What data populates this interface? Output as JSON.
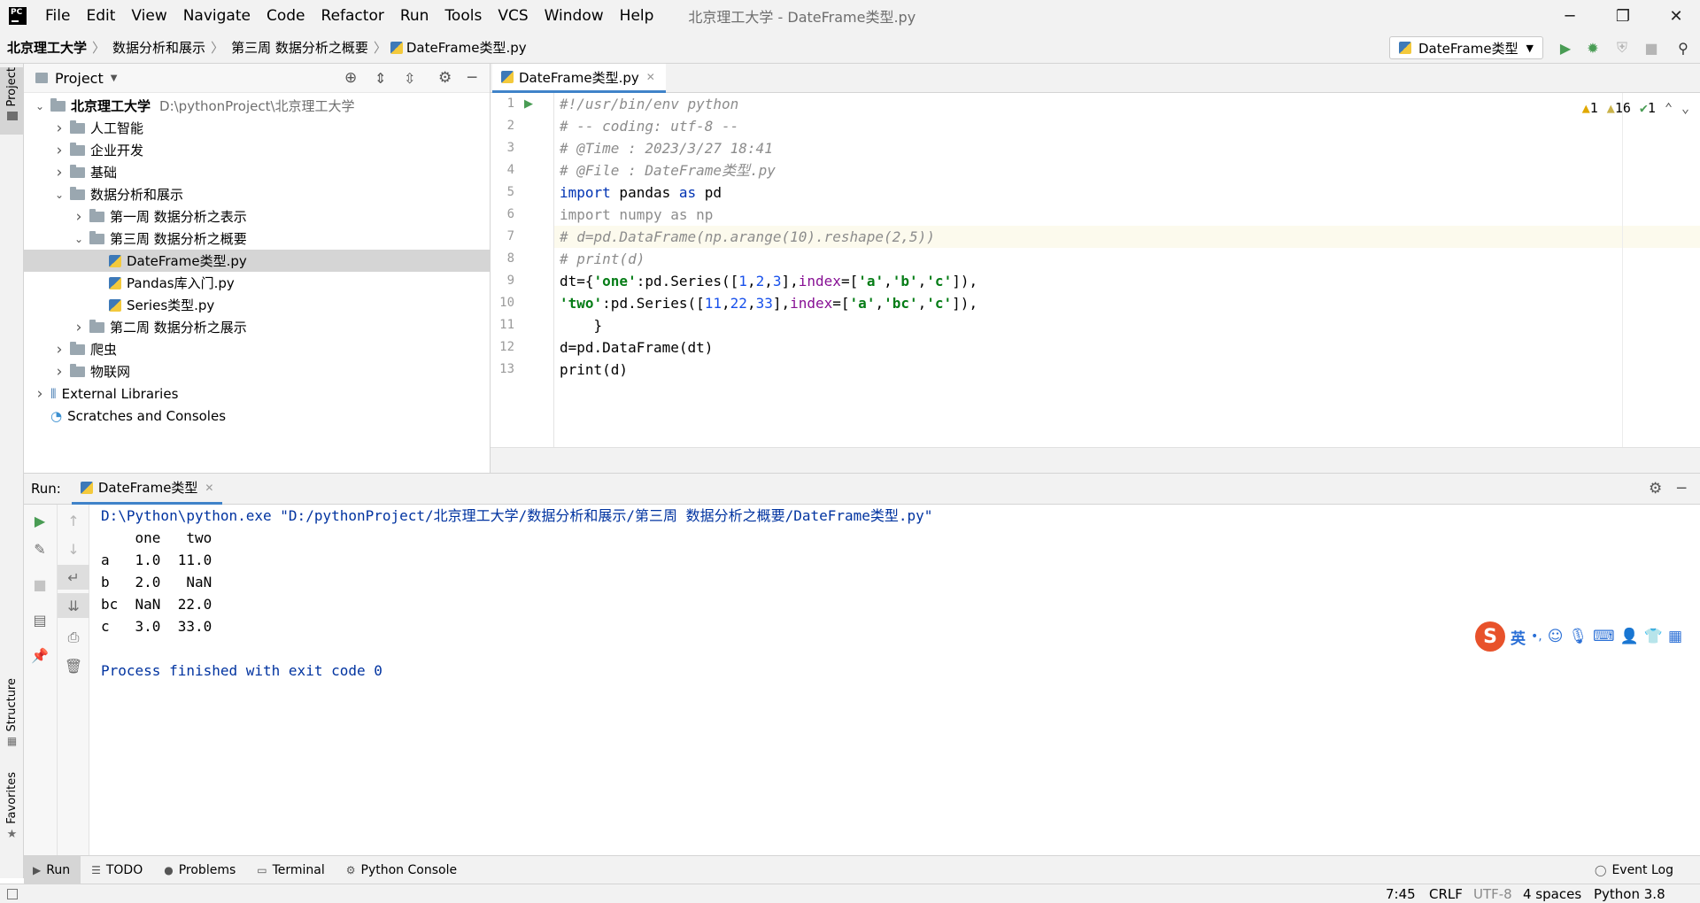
{
  "titlebar": {
    "menu": [
      "File",
      "Edit",
      "View",
      "Navigate",
      "Code",
      "Refactor",
      "Run",
      "Tools",
      "VCS",
      "Window",
      "Help"
    ],
    "window_title": "北京理工大学 - DateFrame类型.py",
    "minimize": "─",
    "restore": "❐",
    "close": "✕"
  },
  "navbar": {
    "crumbs": [
      "北京理工大学",
      "数据分析和展示",
      "第三周 数据分析之概要",
      "DateFrame类型.py"
    ],
    "run_config": "DateFrame类型"
  },
  "left_strip": {
    "project_label": "Project",
    "structure_label": "Structure",
    "favorites_label": "Favorites"
  },
  "project": {
    "header": "Project",
    "tree": [
      {
        "label": "北京理工大学",
        "hint": "D:\\pythonProject\\北京理工大学",
        "level": 0,
        "expanded": true,
        "kind": "folder"
      },
      {
        "label": "人工智能",
        "level": 1,
        "expanded": false,
        "kind": "folder"
      },
      {
        "label": "企业开发",
        "level": 1,
        "expanded": false,
        "kind": "folder"
      },
      {
        "label": "基础",
        "level": 1,
        "expanded": false,
        "kind": "folder"
      },
      {
        "label": "数据分析和展示",
        "level": 1,
        "expanded": true,
        "kind": "folder"
      },
      {
        "label": "第一周 数据分析之表示",
        "level": 2,
        "expanded": false,
        "kind": "folder"
      },
      {
        "label": "第三周 数据分析之概要",
        "level": 2,
        "expanded": true,
        "kind": "folder"
      },
      {
        "label": "DateFrame类型.py",
        "level": 3,
        "kind": "py",
        "selected": true
      },
      {
        "label": "Pandas库入门.py",
        "level": 3,
        "kind": "py"
      },
      {
        "label": "Series类型.py",
        "level": 3,
        "kind": "py"
      },
      {
        "label": "第二周 数据分析之展示",
        "level": 2,
        "expanded": false,
        "kind": "folder"
      },
      {
        "label": "爬虫",
        "level": 1,
        "expanded": false,
        "kind": "folder"
      },
      {
        "label": "物联网",
        "level": 1,
        "expanded": false,
        "kind": "folder"
      },
      {
        "label": "External Libraries",
        "level": 0,
        "expanded": false,
        "kind": "lib"
      },
      {
        "label": "Scratches and Consoles",
        "level": 0,
        "kind": "scratch"
      }
    ]
  },
  "editor": {
    "tab": "DateFrame类型.py",
    "inspection": {
      "warnings": "1",
      "weak_warnings": "16",
      "ok": "1"
    },
    "line_numbers": [
      "1",
      "2",
      "3",
      "4",
      "5",
      "6",
      "7",
      "8",
      "9",
      "10",
      "11",
      "12",
      "13"
    ],
    "lines": [
      "#!/usr/bin/env python",
      "# -- coding: utf-8 --",
      "# @Time : 2023/3/27 18:41",
      "# @File : DateFrame类型.py",
      "import pandas as pd",
      "import numpy as np",
      "# d=pd.DataFrame(np.arange(10).reshape(2,5))",
      "# print(d)",
      "dt={'one':pd.Series([1,2,3],index=['a','b','c']),",
      "'two':pd.Series([11,22,33],index=['a','bc','c']),",
      "    }",
      "d=pd.DataFrame(dt)",
      "print(d)"
    ]
  },
  "run": {
    "label": "Run:",
    "tab": "DateFrame类型",
    "console": [
      "D:\\Python\\python.exe \"D:/pythonProject/北京理工大学/数据分析和展示/第三周 数据分析之概要/DateFrame类型.py\"",
      "    one   two",
      "a   1.0  11.0",
      "b   2.0   NaN",
      "bc  NaN  22.0",
      "c   3.0  33.0",
      "",
      "Process finished with exit code 0"
    ]
  },
  "ime": {
    "logo": "S",
    "lang": "英",
    "punct": "•,"
  },
  "bottom_tabs": [
    "Run",
    "TODO",
    "Problems",
    "Terminal",
    "Python Console"
  ],
  "event_log": "Event Log",
  "status": {
    "position": "7:45",
    "line_sep": "CRLF",
    "encoding": "UTF-8",
    "indent": "4 spaces",
    "interpreter": "Python 3.8"
  },
  "colors": {
    "accent": "#4083c9",
    "run_green": "#499c54",
    "comment": "#8c8c8c",
    "keyword": "#0033b3",
    "string": "#067d17"
  }
}
